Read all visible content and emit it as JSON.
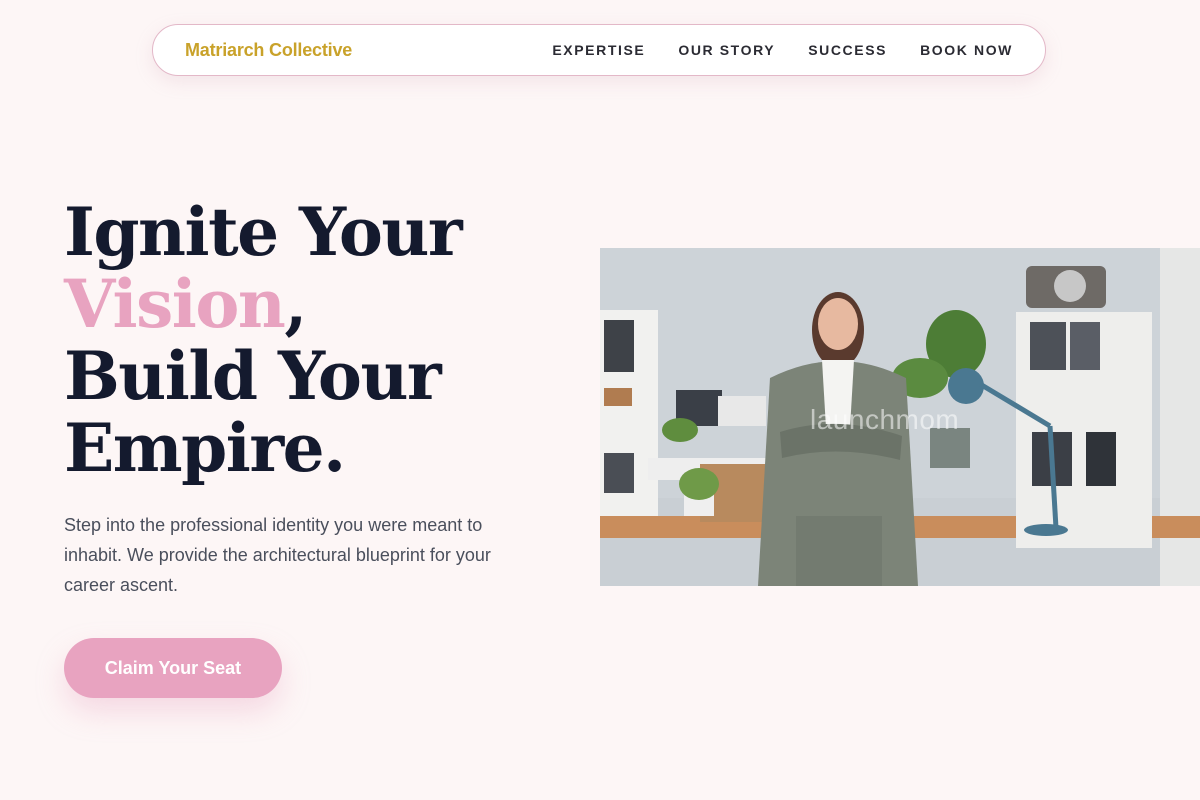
{
  "nav": {
    "brand": "Matriarch Collective",
    "links": [
      {
        "label": "EXPERTISE"
      },
      {
        "label": "OUR STORY"
      },
      {
        "label": "SUCCESS"
      },
      {
        "label": "BOOK NOW"
      }
    ]
  },
  "hero": {
    "title_line1": "Ignite Your",
    "title_accent": "Vision",
    "title_comma": ",",
    "title_line3": "Build Your",
    "title_line4": "Empire.",
    "subtitle": "Step into the professional identity you were meant to inhabit. We provide the architectural blueprint for your career ascent.",
    "cta_label": "Claim Your Seat"
  },
  "image": {
    "watermark": "launchmom",
    "alt_subject": "woman in grey suit in home office"
  },
  "colors": {
    "background": "#fdf6f6",
    "accent_pink": "#e8a3c0",
    "brand_gold": "#c9a22a",
    "heading": "#141a2e"
  }
}
